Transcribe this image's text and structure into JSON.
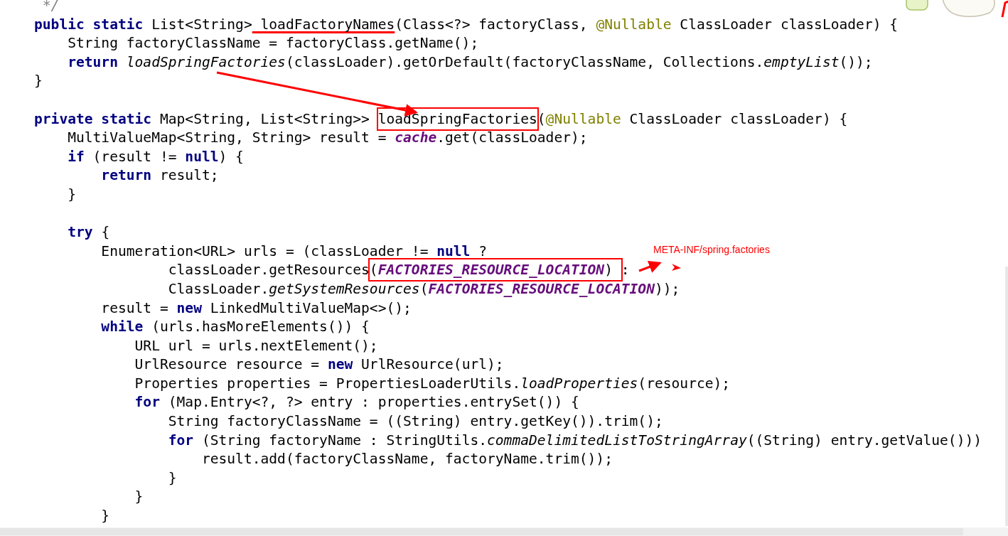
{
  "code_lines": [
    {
      "kind": "code",
      "tokens": [
        {
          "kind": "comment",
          "s": " */"
        }
      ]
    },
    {
      "kind": "code",
      "tokens": [
        {
          "kind": "kw",
          "s": "public static "
        },
        {
          "kind": "txt",
          "s": "List<String>"
        },
        {
          "kind": "txt",
          "s": " loadFactoryNames",
          "underlined": true
        },
        {
          "kind": "txt",
          "s": "(Class<?> factoryClass, "
        },
        {
          "kind": "ann",
          "s": "@Nullable"
        },
        {
          "kind": "txt",
          "s": " ClassLoader classLoader) {"
        }
      ]
    },
    {
      "kind": "code",
      "tokens": [
        {
          "kind": "txt",
          "s": "    String factoryClassName = factoryClass.getName();"
        }
      ]
    },
    {
      "kind": "code",
      "tokens": [
        {
          "kind": "kw",
          "s": "    return "
        },
        {
          "kind": "it",
          "s": "loadSpringFactories"
        },
        {
          "kind": "txt",
          "s": "(classLoader).getOrDefault(factoryClassName, Collections."
        },
        {
          "kind": "it",
          "s": "emptyList"
        },
        {
          "kind": "txt",
          "s": "());"
        }
      ]
    },
    {
      "kind": "code",
      "tokens": [
        {
          "kind": "txt",
          "s": "}"
        }
      ]
    },
    {
      "kind": "blank"
    },
    {
      "kind": "code",
      "tokens": [
        {
          "kind": "kw",
          "s": "private static "
        },
        {
          "kind": "txt",
          "s": "Map<String, List<String>> "
        },
        {
          "kind": "txt",
          "s": "loadSpringFactories",
          "boxed": true
        },
        {
          "kind": "txt",
          "s": "("
        },
        {
          "kind": "ann",
          "s": "@Nullable"
        },
        {
          "kind": "txt",
          "s": " ClassLoader classLoader) {"
        }
      ]
    },
    {
      "kind": "code",
      "tokens": [
        {
          "kind": "txt",
          "s": "    MultiValueMap<String, String> result = "
        },
        {
          "kind": "field",
          "s": "cache"
        },
        {
          "kind": "txt",
          "s": ".get(classLoader);"
        }
      ]
    },
    {
      "kind": "code",
      "tokens": [
        {
          "kind": "kw",
          "s": "    if "
        },
        {
          "kind": "txt",
          "s": "(result != "
        },
        {
          "kind": "kw",
          "s": "null"
        },
        {
          "kind": "txt",
          "s": ") {"
        }
      ]
    },
    {
      "kind": "code",
      "tokens": [
        {
          "kind": "kw",
          "s": "        return "
        },
        {
          "kind": "txt",
          "s": "result;"
        }
      ]
    },
    {
      "kind": "code",
      "tokens": [
        {
          "kind": "txt",
          "s": "    }"
        }
      ]
    },
    {
      "kind": "blank"
    },
    {
      "kind": "code",
      "tokens": [
        {
          "kind": "kw",
          "s": "    try "
        },
        {
          "kind": "txt",
          "s": "{"
        }
      ]
    },
    {
      "kind": "code",
      "tokens": [
        {
          "kind": "txt",
          "s": "        Enumeration<URL> urls = (classLoader != "
        },
        {
          "kind": "kw",
          "s": "null "
        },
        {
          "kind": "txt",
          "s": "?"
        }
      ]
    },
    {
      "kind": "code",
      "tokens": [
        {
          "kind": "txt",
          "s": "                classLoader.getResources"
        },
        {
          "kind": "txt",
          "s": "(",
          "boxed": true
        },
        {
          "kind": "const",
          "s": "FACTORIES_RESOURCE_LOCATION",
          "boxed": true
        },
        {
          "kind": "txt",
          "s": ") ",
          "boxed": true
        },
        {
          "kind": "txt",
          "s": ":"
        }
      ]
    },
    {
      "kind": "code",
      "tokens": [
        {
          "kind": "txt",
          "s": "                ClassLoader."
        },
        {
          "kind": "it",
          "s": "getSystemResources"
        },
        {
          "kind": "txt",
          "s": "("
        },
        {
          "kind": "const",
          "s": "FACTORIES_RESOURCE_LOCATION"
        },
        {
          "kind": "txt",
          "s": "));"
        }
      ]
    },
    {
      "kind": "code",
      "tokens": [
        {
          "kind": "txt",
          "s": "        result = "
        },
        {
          "kind": "kw",
          "s": "new "
        },
        {
          "kind": "txt",
          "s": "LinkedMultiValueMap<>();"
        }
      ]
    },
    {
      "kind": "code",
      "tokens": [
        {
          "kind": "kw",
          "s": "        while "
        },
        {
          "kind": "txt",
          "s": "(urls.hasMoreElements()) {"
        }
      ]
    },
    {
      "kind": "code",
      "tokens": [
        {
          "kind": "txt",
          "s": "            URL url = urls.nextElement();"
        }
      ]
    },
    {
      "kind": "code",
      "tokens": [
        {
          "kind": "txt",
          "s": "            UrlResource resource = "
        },
        {
          "kind": "kw",
          "s": "new "
        },
        {
          "kind": "txt",
          "s": "UrlResource(url);"
        }
      ]
    },
    {
      "kind": "code",
      "tokens": [
        {
          "kind": "txt",
          "s": "            Properties properties = PropertiesLoaderUtils."
        },
        {
          "kind": "it",
          "s": "loadProperties"
        },
        {
          "kind": "txt",
          "s": "(resource);"
        }
      ]
    },
    {
      "kind": "code",
      "tokens": [
        {
          "kind": "kw",
          "s": "            for "
        },
        {
          "kind": "txt",
          "s": "(Map.Entry<?, ?> entry : properties.entrySet()) {"
        }
      ]
    },
    {
      "kind": "code",
      "tokens": [
        {
          "kind": "txt",
          "s": "                String factoryClassName = ((String) entry.getKey()).trim();"
        }
      ]
    },
    {
      "kind": "code",
      "tokens": [
        {
          "kind": "kw",
          "s": "                for "
        },
        {
          "kind": "txt",
          "s": "(String factoryName : StringUtils."
        },
        {
          "kind": "it",
          "s": "commaDelimitedListToStringArray"
        },
        {
          "kind": "txt",
          "s": "((String) entry.getValue()))"
        }
      ]
    },
    {
      "kind": "code",
      "tokens": [
        {
          "kind": "txt",
          "s": "                    result.add(factoryClassName, factoryName.trim());"
        }
      ]
    },
    {
      "kind": "code",
      "tokens": [
        {
          "kind": "txt",
          "s": "                }"
        }
      ]
    },
    {
      "kind": "code",
      "tokens": [
        {
          "kind": "txt",
          "s": "            }"
        }
      ]
    },
    {
      "kind": "code",
      "tokens": [
        {
          "kind": "txt",
          "s": "        }"
        }
      ]
    }
  ],
  "annotation": {
    "note": "META-INF/spring.factories"
  }
}
